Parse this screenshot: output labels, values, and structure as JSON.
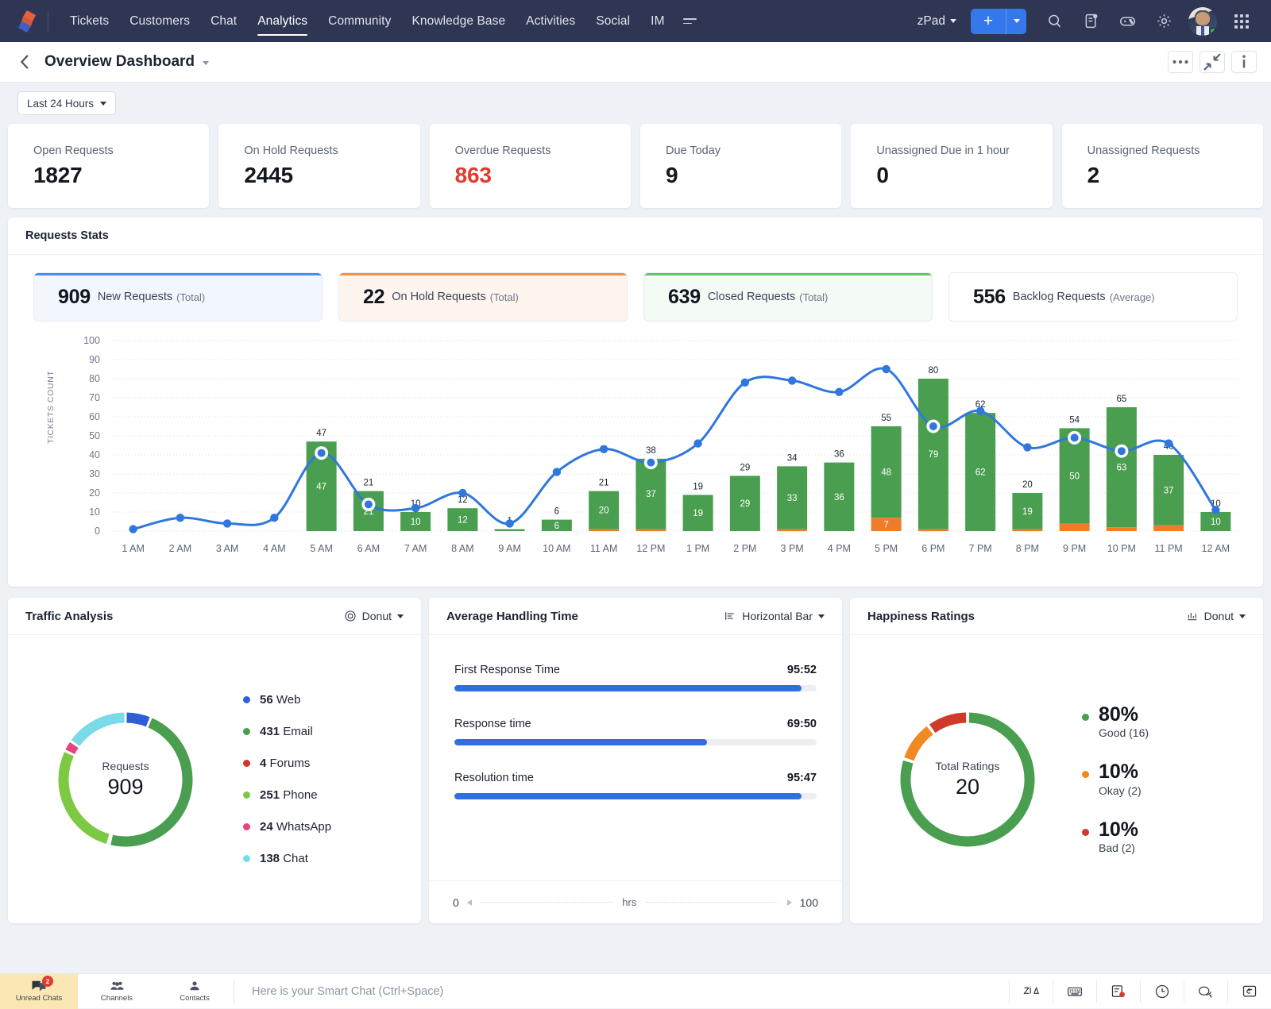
{
  "topnav": {
    "logo_name": "app-logo",
    "items": [
      {
        "label": "Tickets",
        "active": false
      },
      {
        "label": "Customers",
        "active": false
      },
      {
        "label": "Chat",
        "active": false
      },
      {
        "label": "Analytics",
        "active": true
      },
      {
        "label": "Community",
        "active": false
      },
      {
        "label": "Knowledge Base",
        "active": false
      },
      {
        "label": "Activities",
        "active": false
      },
      {
        "label": "Social",
        "active": false
      },
      {
        "label": "IM",
        "active": false
      }
    ],
    "zpad_label": "zPad",
    "add_label": "+",
    "icons": [
      "search-icon",
      "notes-icon",
      "gamepad-icon",
      "gear-icon",
      "avatar",
      "apps-grid-icon"
    ]
  },
  "dashheader": {
    "back_label": "‹",
    "title": "Overview Dashboard",
    "buttons": [
      "more-options",
      "collapse",
      "info"
    ]
  },
  "filter": {
    "range_label": "Last 24 Hours"
  },
  "kpis": [
    {
      "label": "Open Requests",
      "value": "1827",
      "danger": false
    },
    {
      "label": "On Hold Requests",
      "value": "2445",
      "danger": false
    },
    {
      "label": "Overdue Requests",
      "value": "863",
      "danger": true
    },
    {
      "label": "Due Today",
      "value": "9",
      "danger": false
    },
    {
      "label": "Unassigned Due in 1 hour",
      "value": "0",
      "danger": false
    },
    {
      "label": "Unassigned Requests",
      "value": "2",
      "danger": false
    }
  ],
  "stats_panel": {
    "title": "Requests Stats",
    "cards": [
      {
        "num": "909",
        "label": "New Requests",
        "sub": "(Total)",
        "accent": "#4a8cf0",
        "bg": "#f2f6fd"
      },
      {
        "num": "22",
        "label": "On Hold Requests",
        "sub": "(Total)",
        "accent": "#f0914a",
        "bg": "#fef5ef"
      },
      {
        "num": "639",
        "label": "Closed Requests",
        "sub": "(Total)",
        "accent": "#6abf69",
        "bg": "#f4faf4"
      },
      {
        "num": "556",
        "label": "Backlog Requests",
        "sub": "(Average)",
        "accent": "#ffffff",
        "bg": "#ffffff"
      }
    ]
  },
  "chart_data": {
    "type": "bar",
    "title": "Requests Stats",
    "xlabel": "",
    "ylabel": "TICKETS COUNT",
    "ylim": [
      0,
      100
    ],
    "yticks": [
      0,
      10,
      20,
      30,
      40,
      50,
      60,
      70,
      80,
      90,
      100
    ],
    "grid": true,
    "legend": "none",
    "categories": [
      "1 AM",
      "2 AM",
      "3 AM",
      "4 AM",
      "5 AM",
      "6 AM",
      "7 AM",
      "8 AM",
      "9 AM",
      "10 AM",
      "11 AM",
      "12 PM",
      "1 PM",
      "2 PM",
      "3 PM",
      "4 PM",
      "5 PM",
      "6 PM",
      "7 PM",
      "8 PM",
      "9 PM",
      "10 PM",
      "11 PM",
      "12 AM"
    ],
    "totals": [
      null,
      null,
      null,
      null,
      47,
      21,
      10,
      12,
      1,
      6,
      21,
      38,
      19,
      29,
      34,
      36,
      55,
      80,
      62,
      20,
      54,
      65,
      40,
      10
    ],
    "series": [
      {
        "name": "New Requests",
        "color": "#4a9e4f",
        "values": [
          0,
          0,
          0,
          0,
          47,
          21,
          10,
          12,
          1,
          6,
          20,
          37,
          19,
          29,
          33,
          36,
          48,
          79,
          62,
          19,
          50,
          63,
          37,
          10
        ]
      },
      {
        "name": "On Hold Requests",
        "color": "#ef7c28",
        "values": [
          0,
          0,
          0,
          0,
          0,
          0,
          0,
          0,
          0,
          0,
          1,
          1,
          0,
          0,
          1,
          0,
          7,
          1,
          0,
          1,
          4,
          2,
          3,
          0
        ]
      },
      {
        "name": "Closed Requests",
        "color": "#2f77dd",
        "type": "line",
        "values": [
          1,
          7,
          4,
          7,
          41,
          14,
          12,
          20,
          4,
          31,
          43,
          36,
          46,
          78,
          79,
          73,
          85,
          55,
          63,
          44,
          49,
          42,
          46,
          11
        ]
      }
    ],
    "highlighted_points": [
      "5 AM",
      "6 AM",
      "12 PM",
      "6 PM",
      "9 PM",
      "10 PM"
    ]
  },
  "traffic": {
    "title": "Traffic Analysis",
    "chart_type": "Donut",
    "center_label": "Requests",
    "center_value": "909",
    "chart_data": {
      "type": "pie",
      "title": "Traffic Analysis",
      "labels": [
        "Web",
        "Email",
        "Forums",
        "Phone",
        "WhatsApp",
        "Chat"
      ],
      "values": [
        56,
        431,
        4,
        251,
        24,
        138
      ],
      "colors": [
        "#2f5fd6",
        "#4a9e4f",
        "#d0352a",
        "#7ec943",
        "#e8437c",
        "#7adbe8"
      ],
      "total": 909
    },
    "legend": [
      {
        "value": "56",
        "name": "Web",
        "color": "#2f5fd6"
      },
      {
        "value": "431",
        "name": "Email",
        "color": "#4a9e4f"
      },
      {
        "value": "4",
        "name": "Forums",
        "color": "#d0352a"
      },
      {
        "value": "251",
        "name": "Phone",
        "color": "#7ec943"
      },
      {
        "value": "24",
        "name": "WhatsApp",
        "color": "#e8437c"
      },
      {
        "value": "138",
        "name": "Chat",
        "color": "#7adbe8"
      }
    ]
  },
  "aht": {
    "title": "Average Handling Time",
    "chart_type": "Horizontal Bar",
    "chart_data": {
      "type": "bar",
      "orientation": "horizontal",
      "title": "Average Handling Time",
      "categories": [
        "First Response Time",
        "Response time",
        "Resolution time"
      ],
      "value_labels": [
        "95:52",
        "69:50",
        "95:47"
      ],
      "values": [
        95.87,
        69.83,
        95.78
      ],
      "xlim": [
        0,
        100
      ],
      "xlabel": "hrs"
    },
    "rows": [
      {
        "name": "First Response Time",
        "value": "95:52",
        "pct": 95.9
      },
      {
        "name": "Response time",
        "value": "69:50",
        "pct": 69.8
      },
      {
        "name": "Resolution time",
        "value": "95:47",
        "pct": 95.8
      }
    ],
    "axis_min": "0",
    "axis_unit": "hrs",
    "axis_max": "100"
  },
  "happiness": {
    "title": "Happiness Ratings",
    "chart_type": "Donut",
    "center_label": "Total Ratings",
    "center_value": "20",
    "chart_data": {
      "type": "pie",
      "title": "Happiness Ratings",
      "labels": [
        "Good",
        "Okay",
        "Bad"
      ],
      "values": [
        16,
        2,
        2
      ],
      "percents": [
        80,
        10,
        10
      ],
      "colors": [
        "#4a9e4f",
        "#ef8a23",
        "#cf3a2b"
      ],
      "total": 20
    },
    "legend": [
      {
        "pct": "80%",
        "sub": "Good (16)",
        "color": "#4a9e4f"
      },
      {
        "pct": "10%",
        "sub": "Okay (2)",
        "color": "#ef8a23"
      },
      {
        "pct": "10%",
        "sub": "Bad (2)",
        "color": "#cf3a2b"
      }
    ]
  },
  "taskbar": {
    "items": [
      {
        "label": "Unread Chats",
        "badge": "2",
        "icon": "chat-bubbles-icon",
        "active": true
      },
      {
        "label": "Channels",
        "badge": "",
        "icon": "channels-icon",
        "active": false
      },
      {
        "label": "Contacts",
        "badge": "",
        "icon": "contact-icon",
        "active": false
      }
    ],
    "smartchat_placeholder": "Here is your Smart Chat (Ctrl+Space)",
    "right_icons": [
      "zia-icon",
      "keyboard-icon",
      "notes-icon",
      "clock-icon",
      "chat-icon",
      "reply-icon"
    ]
  }
}
